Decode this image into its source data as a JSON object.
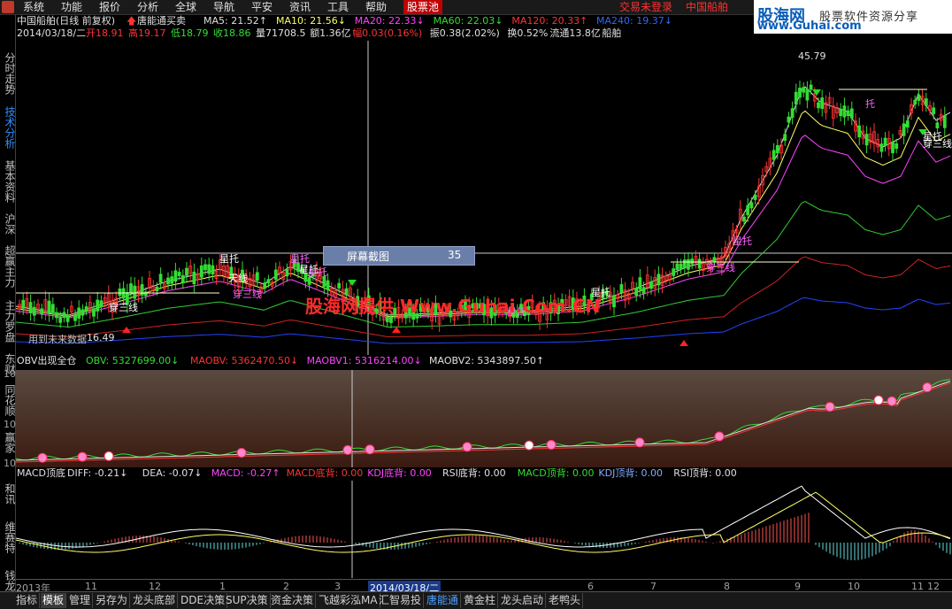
{
  "menu": {
    "items": [
      "系统",
      "功能",
      "报价",
      "分析",
      "全球",
      "导航",
      "平安",
      "资讯",
      "工具",
      "帮助"
    ],
    "hot": "股票池",
    "status": "交易未登录",
    "stock": "中国船舶"
  },
  "brand": {
    "name": "股海网",
    "slogan": "股票软件资源分享",
    "url": "www.Guhai.com"
  },
  "sidebar": [
    "分时走势",
    "技术分析",
    "基本资料",
    "沪深",
    "超赢主力",
    "主力罗盘",
    "东财",
    "同花顺",
    "赢家",
    "和讯",
    "维赛特",
    "钱龙"
  ],
  "header": {
    "title": "中国船舶(日线 前复权)",
    "indicator": "唐能通买卖",
    "ma": [
      {
        "label": "MA5: 21.52",
        "color": "#e0e0e0",
        "arrow": "↑"
      },
      {
        "label": "MA10: 21.56",
        "color": "#ffff66",
        "arrow": "↓"
      },
      {
        "label": "MA20: 22.33",
        "color": "#ff44ff",
        "arrow": "↓"
      },
      {
        "label": "MA60: 22.03",
        "color": "#33dd33",
        "arrow": "↓"
      },
      {
        "label": "MA120: 20.33",
        "color": "#ff3333",
        "arrow": "↑"
      },
      {
        "label": "MA240: 19.37",
        "color": "#3366ff",
        "arrow": "↓"
      }
    ],
    "quote_date": "2014/03/18/二",
    "quote": [
      {
        "label": "开",
        "value": "18.91",
        "color": "#ff3333"
      },
      {
        "label": "高",
        "value": "19.17",
        "color": "#ff3333"
      },
      {
        "label": "低",
        "value": "18.79",
        "color": "#33dd33"
      },
      {
        "label": "收",
        "value": "18.86",
        "color": "#33dd33"
      },
      {
        "label": "量",
        "value": "71708.5",
        "color": "#e0e0e0"
      },
      {
        "label": "额",
        "value": "1.36亿",
        "color": "#e0e0e0"
      },
      {
        "label": "幅",
        "value": "0.03(0.16%)",
        "color": "#ff3333"
      },
      {
        "label": "振",
        "value": "0.38(2.02%)",
        "color": "#e0e0e0"
      },
      {
        "label": "换",
        "value": "0.52%",
        "color": "#e0e0e0"
      },
      {
        "label": "流通",
        "value": "13.8亿",
        "color": "#e0e0e0"
      },
      {
        "label": "",
        "value": "船舶",
        "color": "#e0e0e0"
      }
    ]
  },
  "main_chart": {
    "price_high": "45.79",
    "price_low_note": "用到未来数据",
    "price_low": "16.49",
    "popup": {
      "label": "屏幕截图",
      "value": "35"
    },
    "watermark": "股海网提供 Www.Guhai.Com.CN",
    "annotations": [
      "星托",
      "星托",
      "星托",
      "星托",
      "星托",
      "星托",
      "星托",
      "星托",
      "穿三线",
      "穿三线",
      "穿三线",
      "穿三线",
      "天线",
      "托"
    ]
  },
  "obv_panel": {
    "title": "OBV出现全仓",
    "values": [
      {
        "label": "OBV: 5327699.00",
        "color": "#33dd33",
        "arrow": "↓"
      },
      {
        "label": "MAOBV: 5362470.50",
        "color": "#ff3333",
        "arrow": "↓"
      },
      {
        "label": "MAOBV1: 5316214.00",
        "color": "#ff44ff",
        "arrow": "↓"
      },
      {
        "label": "MAOBV2: 5343897.50",
        "color": "#e0e0e0",
        "arrow": "↑"
      }
    ],
    "axis": [
      "10",
      "10",
      "10"
    ]
  },
  "macd_panel": {
    "title": "MACD顶底",
    "values": [
      {
        "label": "DIFF: -0.21",
        "color": "#e0e0e0",
        "arrow": "↓"
      },
      {
        "label": "DEA: -0.07",
        "color": "#e0e0e0",
        "arrow": "↓"
      },
      {
        "label": "MACD: -0.27",
        "color": "#ff44ff",
        "arrow": "↑"
      },
      {
        "label": "MACD底背: 0.00",
        "color": "#ff3333",
        "arrow": ""
      },
      {
        "label": "KDJ底背: 0.00",
        "color": "#ff44ff",
        "arrow": ""
      },
      {
        "label": "RSI底背: 0.00",
        "color": "#e0e0e0",
        "arrow": ""
      },
      {
        "label": "MACD顶背: 0.00",
        "color": "#33dd33",
        "arrow": ""
      },
      {
        "label": "KDJ顶背: 0.00",
        "color": "#88aaff",
        "arrow": ""
      },
      {
        "label": "RSI顶背: 0.00",
        "color": "#e0e0e0",
        "arrow": ""
      }
    ]
  },
  "time_axis": {
    "labels": [
      "2013年",
      "11",
      "12",
      "1",
      "2",
      "3",
      "2014/03/18/二",
      "6",
      "7",
      "8",
      "9",
      "10",
      "11",
      "12"
    ]
  },
  "bottom_tabs": [
    "指标",
    "模板",
    "管理",
    "另存为",
    "龙头底部",
    "DDE决策",
    "SUP决策",
    "资金决策",
    "飞越彩泓MA",
    "汇智易投",
    "唐能通",
    "黄金柱",
    "龙头启动",
    "老鸭头"
  ],
  "colors": {
    "bg": "#000000",
    "up": "#ff3333",
    "down": "#33dd33",
    "ma20": "#ff44ff",
    "ma60": "#33dd33",
    "ma120": "#cc2222",
    "ma240": "#2244ff",
    "accent": "#2f8fff"
  }
}
